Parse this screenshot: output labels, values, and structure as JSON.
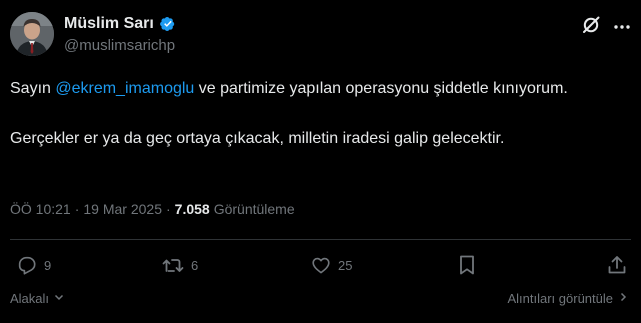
{
  "author": {
    "display_name": "Müslim Sarı",
    "handle": "@muslimsarichp",
    "verified": true
  },
  "tweet": {
    "text_prefix": "Sayın ",
    "mention": "@ekrem_imamoglu",
    "text_line1_suffix": " ve partimize yapılan operasyonu şiddetle kınıyorum.",
    "text_paragraph2": "Gerçekler er ya da geç ortaya çıkacak, milletin iradesi galip gelecektir."
  },
  "meta": {
    "time": "ÖÖ 10:21",
    "separator": "·",
    "date": "19 Mar 2025",
    "views_count": "7.058",
    "views_label": "Görüntüleme"
  },
  "actions": {
    "replies": "9",
    "reposts": "6",
    "likes": "25"
  },
  "footer": {
    "related_label": "Alakalı",
    "quotes_label": "Alıntıları görüntüle"
  },
  "colors": {
    "background": "#000000",
    "text": "#e7e9ea",
    "muted": "#71767b",
    "accent": "#1d9bf0",
    "divider": "#2f3336"
  },
  "icons": {
    "verified": "verified-badge-icon",
    "grok": "grok-icon",
    "more": "more-icon",
    "reply": "reply-icon",
    "repost": "repost-icon",
    "like": "heart-icon",
    "bookmark": "bookmark-icon",
    "share": "share-icon",
    "related_chevron": "chevron-down-icon",
    "quotes_chevron": "chevron-right-icon"
  }
}
